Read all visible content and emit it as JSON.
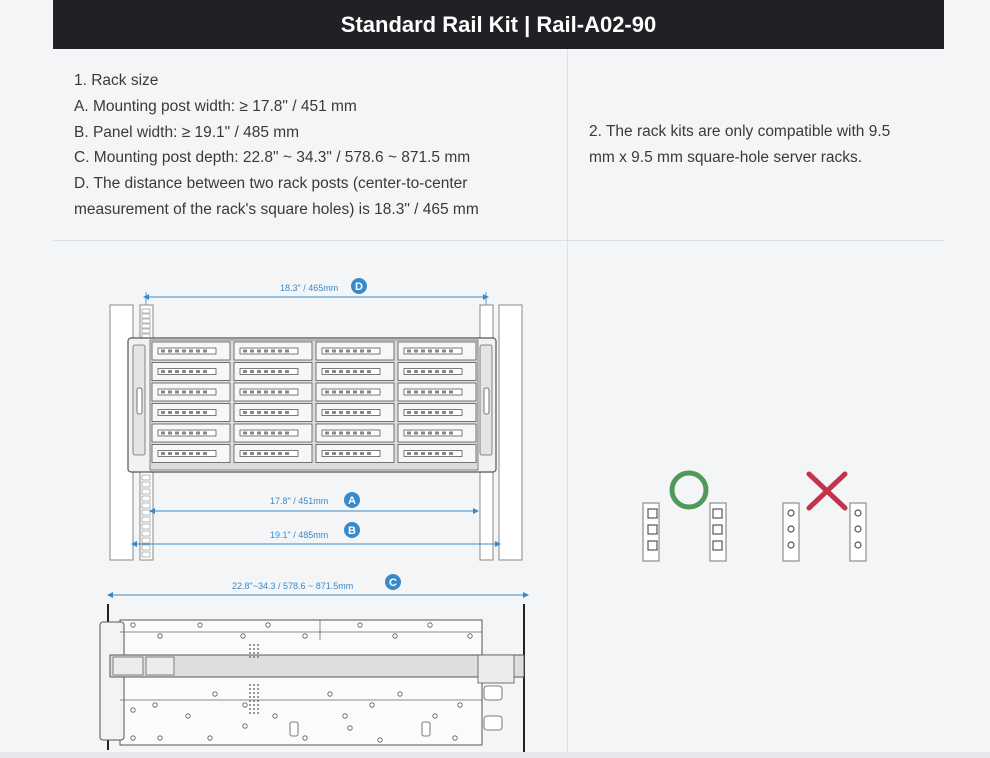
{
  "header": {
    "title": "Standard Rail Kit | Rail-A02-90"
  },
  "left_text": {
    "lines": [
      "1. Rack size",
      "A. Mounting post width: ≥ 17.8\" / 451 mm",
      "B. Panel width: ≥ 19.1\" / 485 mm",
      "C. Mounting post depth: 22.8\" ~ 34.3\" / 578.6 ~ 871.5 mm",
      "D. The distance between two rack posts (center-to-center",
      "measurement of the rack's square holes) is 18.3\" / 465 mm"
    ]
  },
  "right_text": {
    "lines": [
      "2. The rack kits are only compatible with 9.5",
      "mm x 9.5 mm square-hole server racks."
    ]
  },
  "diagram": {
    "label_d": "18.3\" / 465mm",
    "badge_d": "D",
    "label_a": "17.8\" / 451mm",
    "badge_a": "A",
    "label_b": "19.1\" / 485mm",
    "badge_b": "B",
    "label_c": "22.8\"~34.3  /  578.6 ~ 871.5mm",
    "badge_c": "C"
  },
  "colors": {
    "accent_blue": "#3a8ac9",
    "ok_green": "#4f9a58",
    "no_red": "#c2344c",
    "header_bg": "#202124"
  },
  "icons": [
    "compatible-circle-icon",
    "incompatible-cross-icon"
  ]
}
